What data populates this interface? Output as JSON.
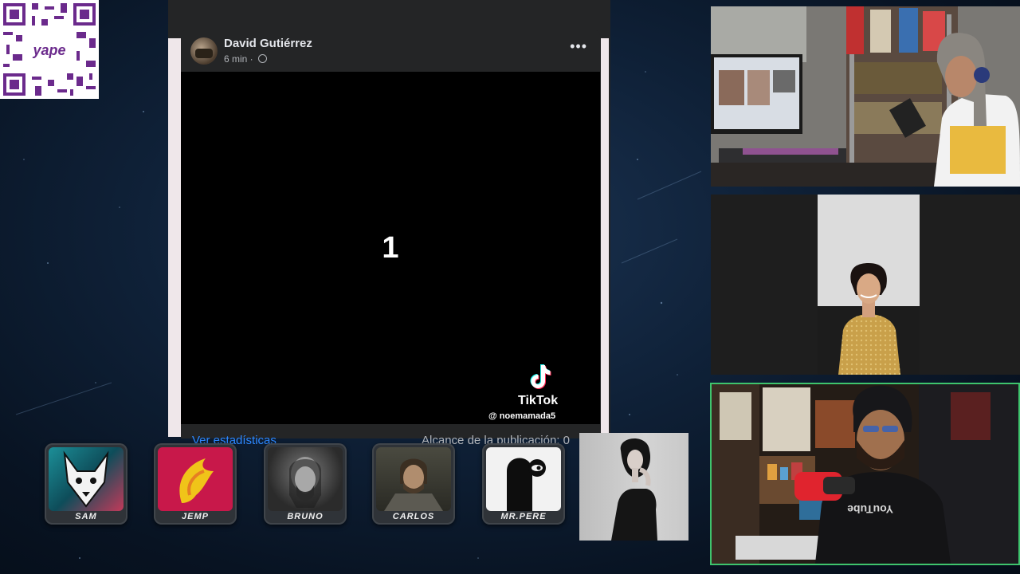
{
  "qr": {
    "brand": "yape"
  },
  "post": {
    "author": "David Gutiérrez",
    "time": "6 min",
    "more_label": "•••",
    "countdown": "1",
    "tiktok_word": "TikTok",
    "tiktok_user": "@ noemamada5",
    "stats_link": "Ver estadísticas",
    "reach": "Alcance de la publicación: 0"
  },
  "players": [
    {
      "name": "SAM"
    },
    {
      "name": "JEMP"
    },
    {
      "name": "BRUNO"
    },
    {
      "name": "CARLOS"
    },
    {
      "name": "MR.PERE"
    }
  ],
  "colors": {
    "fb_card": "#242526",
    "fb_link": "#2d88ff",
    "active_cam_border": "#3ec46d"
  },
  "icons": [
    "qr-code-icon",
    "globe-icon",
    "more-options-icon",
    "tiktok-logo-icon"
  ]
}
